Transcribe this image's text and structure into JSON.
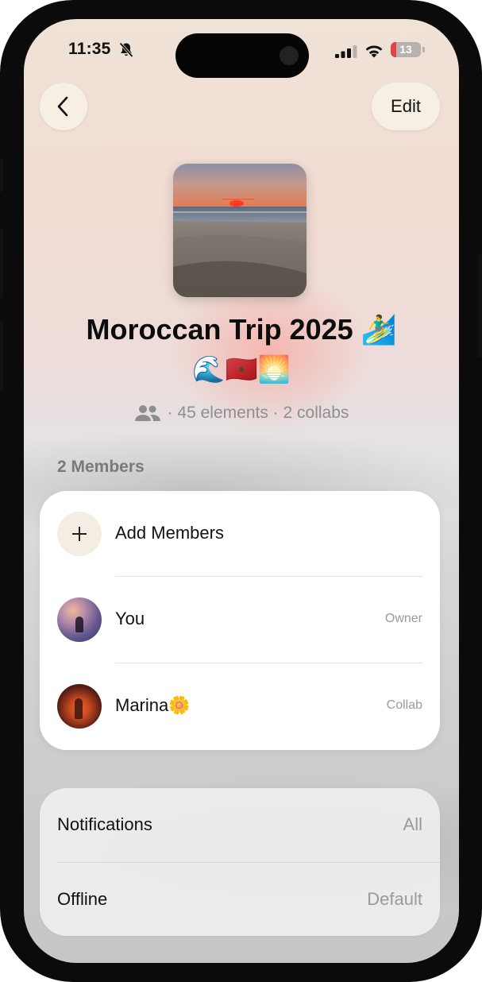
{
  "status_bar": {
    "time": "11:35",
    "battery": "13"
  },
  "header": {
    "edit_label": "Edit"
  },
  "trip": {
    "title": "Moroccan Trip 2025 🏄‍♂️",
    "emojis": "🌊🇲🇦🌅",
    "meta": "· 45 elements · 2 collabs"
  },
  "members": {
    "section_label": "2 Members",
    "add_label": "Add Members",
    "items": [
      {
        "name": "You",
        "role": "Owner"
      },
      {
        "name": "Marina🌼",
        "role": "Collab"
      }
    ]
  },
  "settings": {
    "items": [
      {
        "label": "Notifications",
        "value": "All"
      },
      {
        "label": "Offline",
        "value": "Default"
      }
    ]
  },
  "icons": {
    "back": "chevron-left-icon",
    "people": "people-icon",
    "add": "plus-icon",
    "bell": "bell-slash-icon"
  },
  "colors": {
    "battery_low": "#e2434b",
    "button_bg": "#f7efe4"
  }
}
